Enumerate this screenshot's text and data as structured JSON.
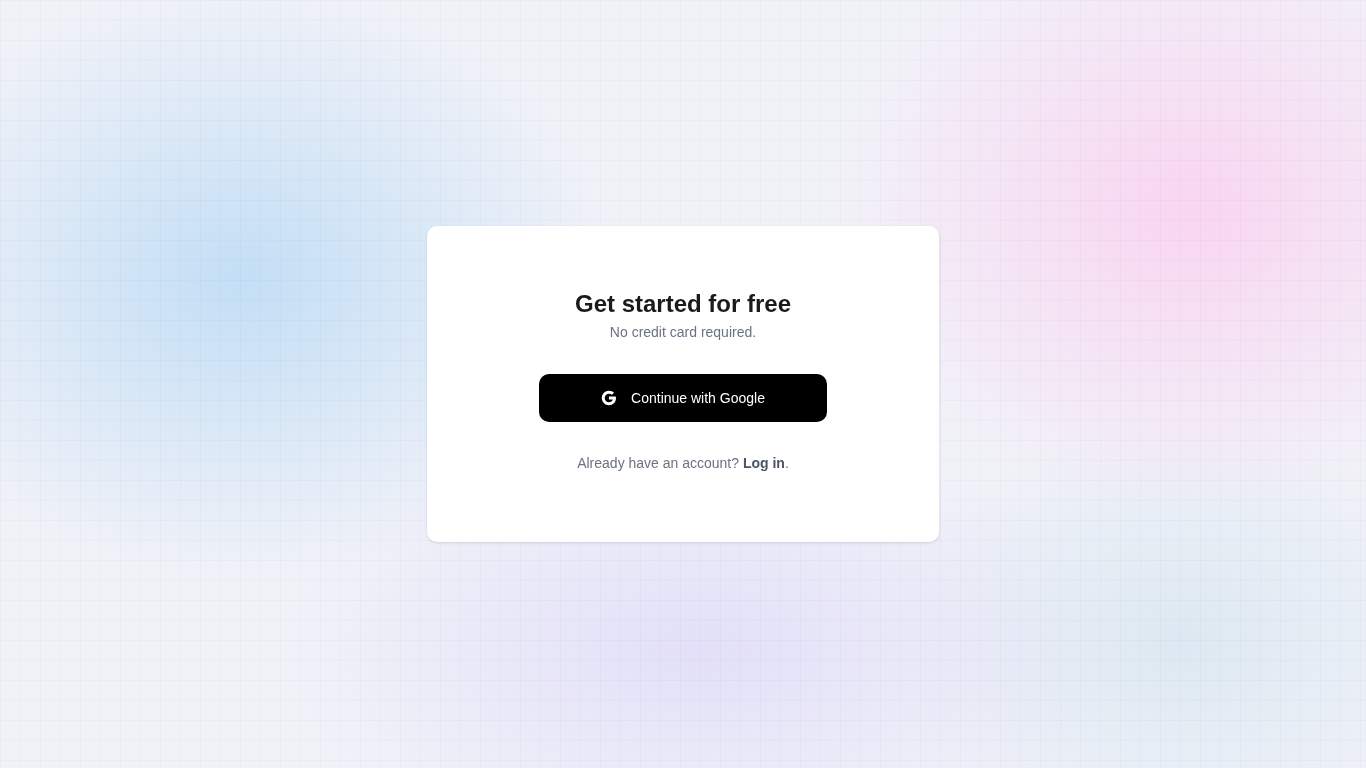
{
  "card": {
    "title": "Get started for free",
    "subtitle": "No credit card required.",
    "button": {
      "label": "Continue with Google"
    },
    "footer": {
      "prompt": "Already have an account?",
      "link": "Log in",
      "ending": "."
    }
  }
}
